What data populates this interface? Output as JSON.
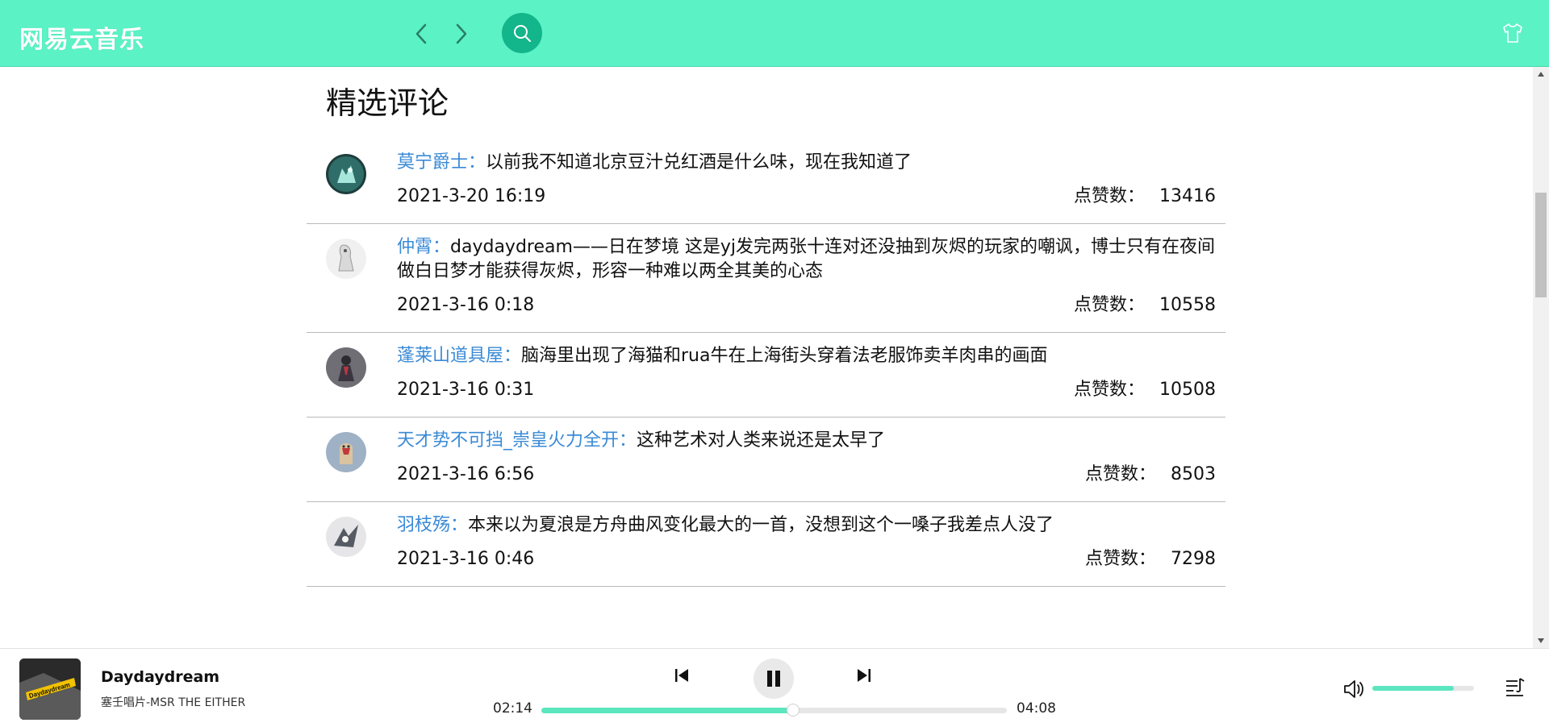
{
  "header": {
    "logo": "网易云音乐"
  },
  "main": {
    "section_title": "精选评论",
    "comments": [
      {
        "user": "莫宁爵士：",
        "text": "以前我不知道北京豆汁兑红酒是什么味，现在我知道了",
        "date": "2021-3-20 16:19",
        "likes_label": "点赞数：",
        "likes": "13416"
      },
      {
        "user": "仲霄：",
        "text": "daydaydream——日在梦境 这是yj发完两张十连对还没抽到灰烬的玩家的嘲讽，博士只有在夜间做白日梦才能获得灰烬，形容一种难以两全其美的心态",
        "date": "2021-3-16 0:18",
        "likes_label": "点赞数：",
        "likes": "10558"
      },
      {
        "user": "蓬莱山道具屋：",
        "text": "脑海里出现了海猫和rua牛在上海街头穿着法老服饰卖羊肉串的画面",
        "date": "2021-3-16 0:31",
        "likes_label": "点赞数：",
        "likes": "10508"
      },
      {
        "user": "天才势不可挡_崇皇火力全开：",
        "text": "这种艺术对人类来说还是太早了",
        "date": "2021-3-16 6:56",
        "likes_label": "点赞数：",
        "likes": "8503"
      },
      {
        "user": "羽枝殇：",
        "text": "本来以为夏浪是方舟曲风变化最大的一首，没想到这个一嗓子我差点人没了",
        "date": "2021-3-16 0:46",
        "likes_label": "点赞数：",
        "likes": "7298"
      }
    ]
  },
  "player": {
    "song_title": "Daydaydream",
    "artist": "塞壬唱片-MSR THE EITHER",
    "album_text": "Daydaydream",
    "current_time": "02:14",
    "total_time": "04:08",
    "progress_fraction": 0.54,
    "volume_fraction": 0.8
  },
  "colors": {
    "header_bg": "#5bf2c6",
    "search_bg": "#13b58a",
    "user_link": "#3a8ad6",
    "progress_fill": "#5be6c0"
  },
  "icons": [
    "chevron-left-icon",
    "chevron-right-icon",
    "search-icon",
    "skin-icon",
    "prev-icon",
    "pause-icon",
    "next-icon",
    "volume-icon",
    "playlist-icon"
  ]
}
